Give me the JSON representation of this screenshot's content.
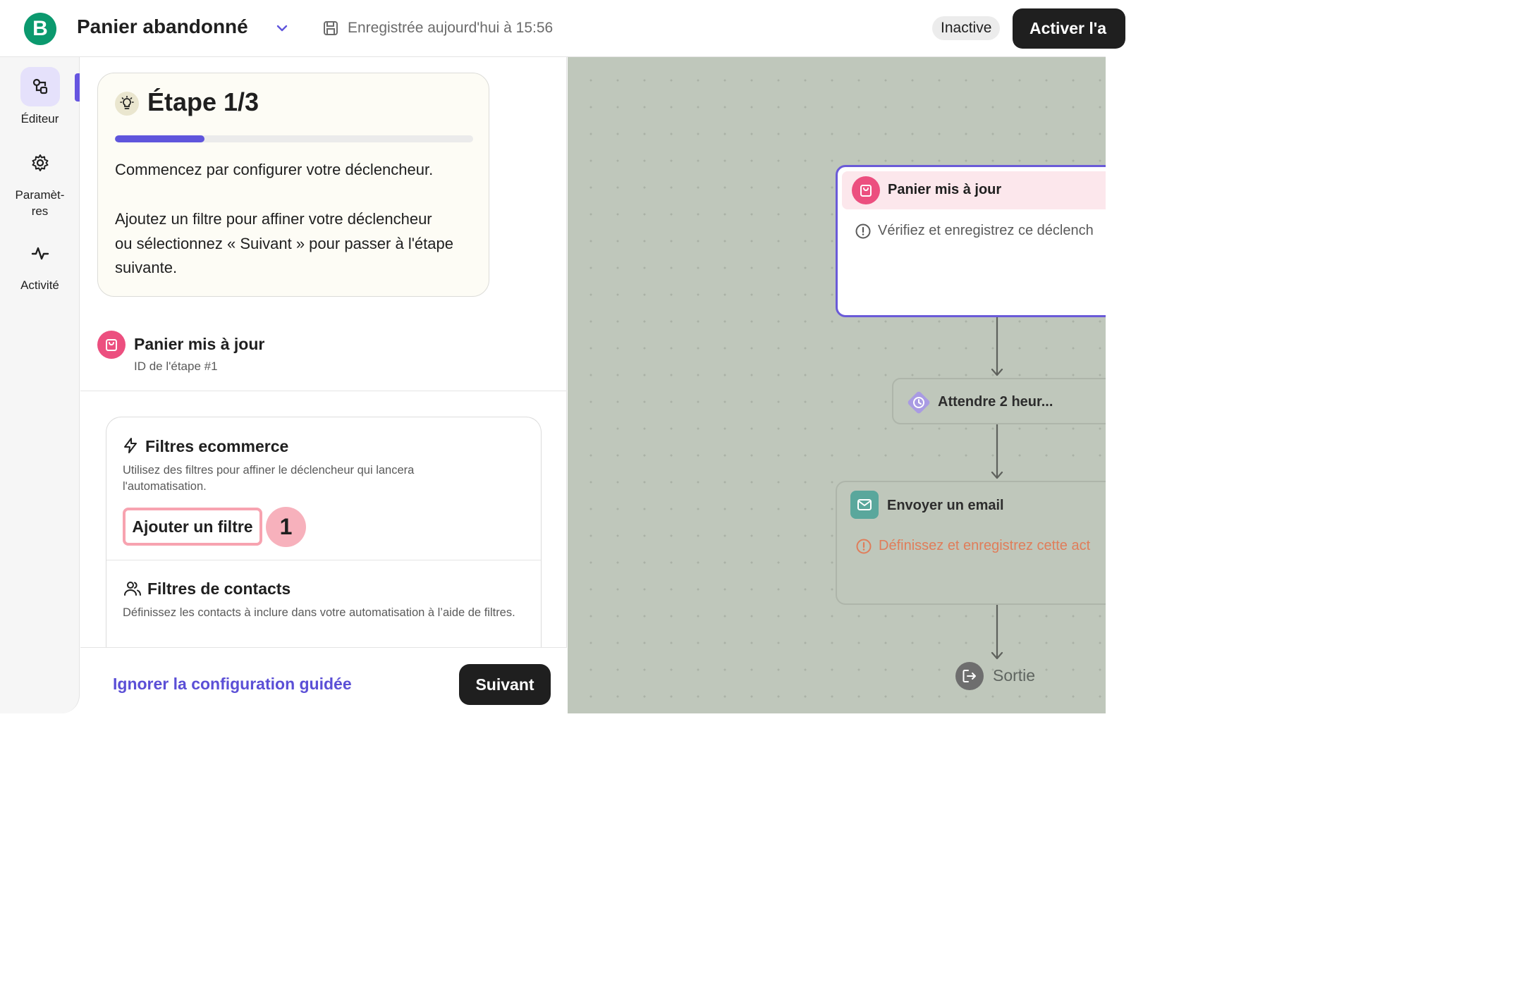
{
  "header": {
    "logo_letter": "B",
    "title": "Panier abandonné",
    "save_status": "Enregistrée aujourd'hui à 15:56",
    "status_badge": "Inactive",
    "activate_label": "Activer l'a"
  },
  "rail": {
    "items": [
      {
        "label": "Éditeur",
        "icon": "editor-icon",
        "active": true
      },
      {
        "label": "Paramèt-\nres",
        "icon": "gear-icon",
        "active": false
      },
      {
        "label": "Activité",
        "icon": "activity-icon",
        "active": false
      }
    ]
  },
  "guide": {
    "step_title": "Étape 1/3",
    "progress_fraction": 0.25,
    "line1": "Commencez par configurer votre déclencheur.",
    "line2": "Ajoutez un filtre pour affiner votre déclencheur ou sélectionnez « Suivant » pour passer à l'étape suivante."
  },
  "trigger": {
    "name": "Panier mis à jour",
    "step_id": "ID de l'étape #1"
  },
  "filters": {
    "ecommerce_title": "Filtres ecommerce",
    "ecommerce_desc": "Utilisez des filtres pour affiner le déclencheur qui lancera l'automatisation.",
    "add_filter_label": "Ajouter un filtre",
    "step_badge": "1",
    "contacts_title": "Filtres de contacts",
    "contacts_desc": "Définissez les contacts à inclure dans votre automatisation à l’aide de filtres."
  },
  "footer": {
    "skip_label": "Ignorer la configuration guidée",
    "next_label": "Suivant"
  },
  "canvas": {
    "trigger_node": {
      "title": "Panier mis à jour",
      "warning": "Vérifiez et enregistrez ce déclench"
    },
    "wait_node": {
      "title": "Attendre 2 heur..."
    },
    "email_node": {
      "title": "Envoyer un email",
      "warning": "Définissez et enregistrez cette act"
    },
    "exit_label": "Sortie"
  },
  "colors": {
    "accent": "#5f55dc",
    "trigger_pink": "#ec4f7f",
    "email_teal": "#5aa79c",
    "warning_orange": "#e07d5a",
    "canvas_bg": "#bfc7bb"
  }
}
